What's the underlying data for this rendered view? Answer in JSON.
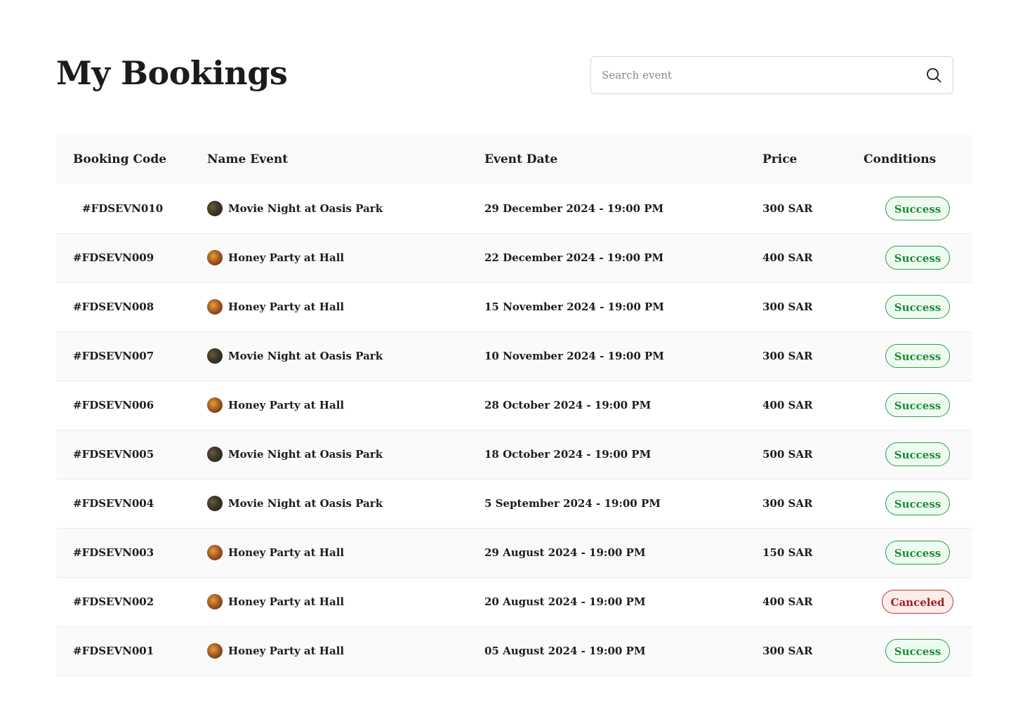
{
  "header": {
    "title": "My Bookings"
  },
  "search": {
    "placeholder": "Search event",
    "value": ""
  },
  "table": {
    "columns": {
      "code": "Booking Code",
      "name": "Name Event",
      "date": "Event Date",
      "price": "Price",
      "conditions": "Conditions"
    },
    "rows": [
      {
        "code": "#FDSEVN010",
        "name": "Movie Night at Oasis Park",
        "thumb": "movie",
        "date": "29 December 2024 - 19:00 PM",
        "price": "300 SAR",
        "status": "Success"
      },
      {
        "code": "#FDSEVN009",
        "name": "Honey Party at Hall",
        "thumb": "honey",
        "date": "22 December 2024 - 19:00 PM",
        "price": "400 SAR",
        "status": "Success"
      },
      {
        "code": "#FDSEVN008",
        "name": "Honey Party at Hall",
        "thumb": "honey",
        "date": "15 November 2024 - 19:00 PM",
        "price": "300 SAR",
        "status": "Success"
      },
      {
        "code": "#FDSEVN007",
        "name": "Movie Night at Oasis Park",
        "thumb": "movie",
        "date": "10 November 2024 - 19:00 PM",
        "price": "300 SAR",
        "status": "Success"
      },
      {
        "code": "#FDSEVN006",
        "name": "Honey Party at Hall",
        "thumb": "honey",
        "date": "28 October 2024 - 19:00 PM",
        "price": "400 SAR",
        "status": "Success"
      },
      {
        "code": "#FDSEVN005",
        "name": "Movie Night at Oasis Park",
        "thumb": "movie",
        "date": "18 October 2024 - 19:00 PM",
        "price": "500 SAR",
        "status": "Success"
      },
      {
        "code": "#FDSEVN004",
        "name": "Movie Night at Oasis Park",
        "thumb": "movie",
        "date": "5 September 2024 - 19:00 PM",
        "price": "300 SAR",
        "status": "Success"
      },
      {
        "code": "#FDSEVN003",
        "name": "Honey Party at Hall",
        "thumb": "honey",
        "date": "29 August 2024 - 19:00 PM",
        "price": "150 SAR",
        "status": "Success"
      },
      {
        "code": "#FDSEVN002",
        "name": "Honey Party at Hall",
        "thumb": "honey",
        "date": "20 August 2024 - 19:00 PM",
        "price": "400 SAR",
        "status": "Canceled"
      },
      {
        "code": "#FDSEVN001",
        "name": "Honey Party at Hall",
        "thumb": "honey",
        "date": "05 August 2024 - 19:00 PM",
        "price": "300 SAR",
        "status": "Success"
      }
    ]
  },
  "icons": {
    "search": "search-icon"
  },
  "colors": {
    "success_text": "#208a3c",
    "success_bg": "#eefbf0",
    "canceled_text": "#a81d1d",
    "canceled_bg": "#fdecec",
    "header_bg": "#f9f9f9"
  }
}
